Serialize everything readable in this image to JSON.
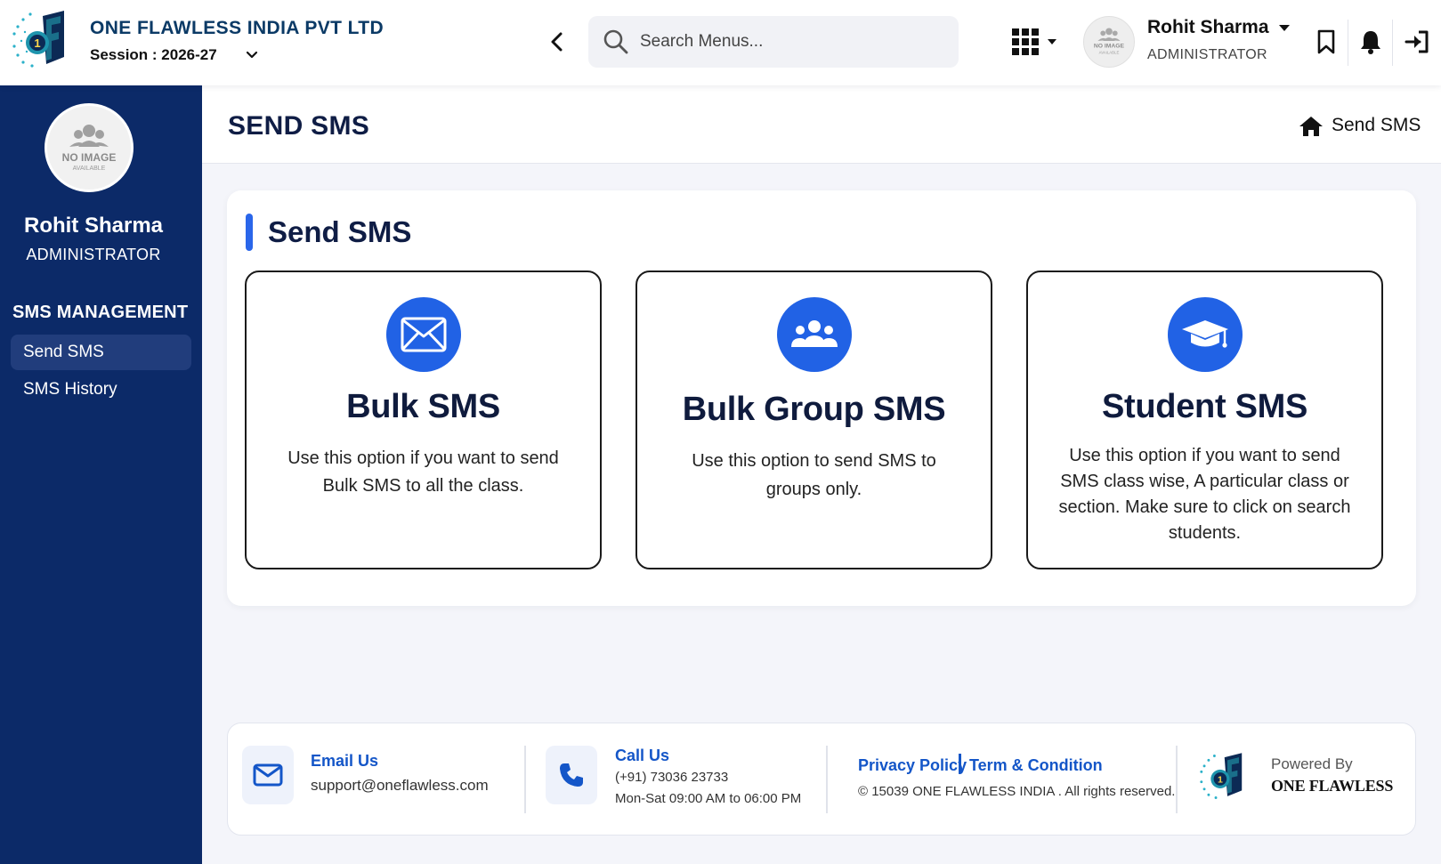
{
  "header": {
    "company_name": "ONE FLAWLESS INDIA PVT LTD",
    "session_label": "Session : 2026-27",
    "search_placeholder": "Search Menus...",
    "user_name": "Rohit Sharma",
    "user_role": "ADMINISTRATOR",
    "avatar_text_top": "NO IMAGE",
    "avatar_text_bottom": "AVAILABLE"
  },
  "sidebar": {
    "user_name": "Rohit Sharma",
    "user_role": "ADMINISTRATOR",
    "avatar_text_top": "NO IMAGE",
    "avatar_text_bottom": "AVAILABLE",
    "section_title": "SMS MANAGEMENT",
    "items": [
      {
        "label": "Send SMS",
        "active": true
      },
      {
        "label": "SMS History",
        "active": false
      }
    ]
  },
  "page": {
    "title": "SEND SMS",
    "breadcrumb": "Send SMS"
  },
  "panel": {
    "title": "Send SMS",
    "options": [
      {
        "icon": "envelope-icon",
        "title": "Bulk SMS",
        "description": "Use this option if you want to send Bulk SMS to all the class."
      },
      {
        "icon": "users-group-icon",
        "title": "Bulk Group SMS",
        "description": "Use this option to send SMS to groups only."
      },
      {
        "icon": "graduation-cap-icon",
        "title": "Student SMS",
        "description": "Use this option if you want to send SMS class wise, A particular class or section. Make sure to click on search students."
      }
    ]
  },
  "footer": {
    "email_label": "Email Us",
    "email_value": "support@oneflawless.com",
    "call_label": "Call Us",
    "call_number": "(+91) 73036 23733",
    "call_hours": "Mon-Sat 09:00 AM to 06:00 PM",
    "privacy_link": "Privacy Policy",
    "terms_link": "Term & Condition",
    "copyright": "© 15039 ONE FLAWLESS INDIA . All rights reserved.",
    "powered_by": "Powered By",
    "powered_name": "ONE FLAWLESS"
  },
  "colors": {
    "sidebar_bg": "#0c2a68",
    "accent": "#2162e5",
    "link": "#1456c8"
  }
}
